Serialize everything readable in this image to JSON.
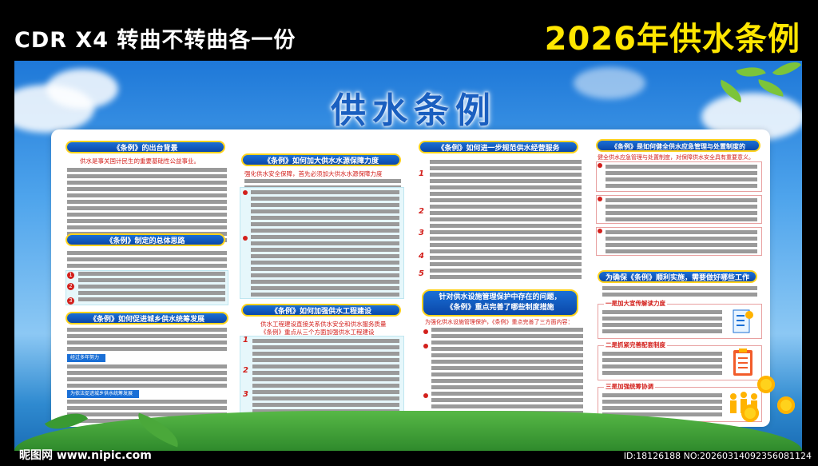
{
  "header": {
    "left_text": "CDR  X4  转曲不转曲各一份",
    "right_text": "2026年供水条例"
  },
  "title": "供水条例",
  "col1": {
    "h1": "《条例》的出台背景",
    "h1_sub": "供水是事关国计民生的重要基础性公益事业。",
    "h2": "《条例》制定的总体思路",
    "h3": "《条例》如何促进城乡供水统筹发展",
    "tag1": "经过多年努力",
    "tag2": "为依法促进城乡供水统筹发展",
    "n1": "1",
    "n2": "2",
    "n3": "3"
  },
  "col2": {
    "h1": "《条例》如何加大供水水源保障力度",
    "h1_sub": "强化供水安全保障，首先必须加大供水水源保障力度",
    "h2": "《条例》如何加强供水工程建设",
    "h2_sub1": "供水工程建设直接关系供水安全和供水服务质量",
    "h2_sub2": "《条例》重点从三个方面加强供水工程建设",
    "n1": "1",
    "n2": "2",
    "n3": "3"
  },
  "col3": {
    "h1": "《条例》如何进一步规范供水经营服务",
    "h2_line1": "针对供水设施管理保护中存在的问题，",
    "h2_line2": "《条例》重点完善了哪些制度措施",
    "h2_sub": "为强化供水设施管理保护，《条例》重点完善了三方面内容：",
    "n1": "1",
    "n2": "2",
    "n3": "3",
    "n4": "4",
    "n5": "5"
  },
  "col4": {
    "h1": "《条例》是如何健全供水应急管理与处置制度的",
    "h1_sub": "健全供水应急管理与处置制度，对保障供水安全具有重要意义。",
    "h2": "为确保《条例》顺利实施，需要做好哪些工作",
    "item1": "一是加大宣传解读力度",
    "item2": "二是抓紧完善配套制度",
    "item3": "三是加强统筹协调"
  },
  "watermark": {
    "left": "昵图网 www.nipic.com",
    "right": "ID:18126188 NO:20260314092356081124"
  },
  "colors": {
    "accent_blue": "#1a6fd6",
    "accent_yellow": "#ffe600",
    "accent_red": "#d3201c"
  }
}
